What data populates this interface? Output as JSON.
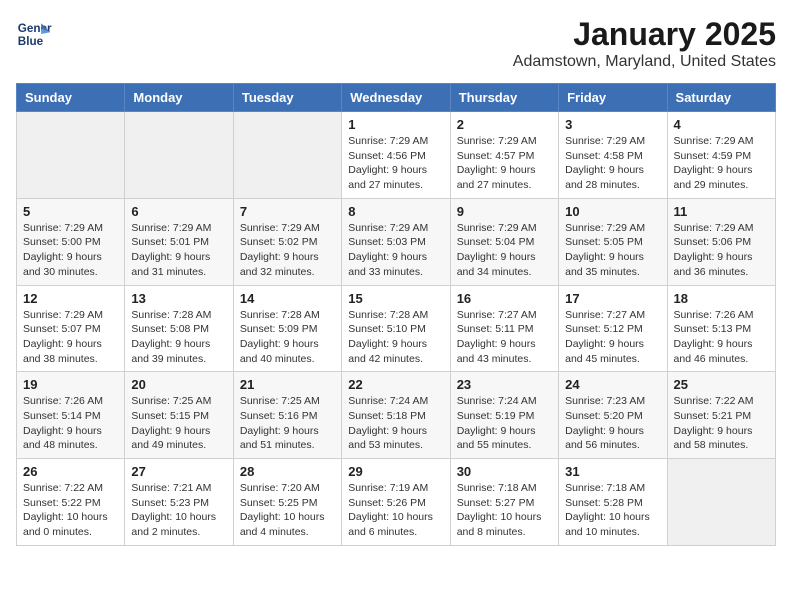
{
  "logo": {
    "line1": "General",
    "line2": "Blue"
  },
  "header": {
    "month": "January 2025",
    "location": "Adamstown, Maryland, United States"
  },
  "weekdays": [
    "Sunday",
    "Monday",
    "Tuesday",
    "Wednesday",
    "Thursday",
    "Friday",
    "Saturday"
  ],
  "weeks": [
    [
      {
        "day": "",
        "info": ""
      },
      {
        "day": "",
        "info": ""
      },
      {
        "day": "",
        "info": ""
      },
      {
        "day": "1",
        "info": "Sunrise: 7:29 AM\nSunset: 4:56 PM\nDaylight: 9 hours\nand 27 minutes."
      },
      {
        "day": "2",
        "info": "Sunrise: 7:29 AM\nSunset: 4:57 PM\nDaylight: 9 hours\nand 27 minutes."
      },
      {
        "day": "3",
        "info": "Sunrise: 7:29 AM\nSunset: 4:58 PM\nDaylight: 9 hours\nand 28 minutes."
      },
      {
        "day": "4",
        "info": "Sunrise: 7:29 AM\nSunset: 4:59 PM\nDaylight: 9 hours\nand 29 minutes."
      }
    ],
    [
      {
        "day": "5",
        "info": "Sunrise: 7:29 AM\nSunset: 5:00 PM\nDaylight: 9 hours\nand 30 minutes."
      },
      {
        "day": "6",
        "info": "Sunrise: 7:29 AM\nSunset: 5:01 PM\nDaylight: 9 hours\nand 31 minutes."
      },
      {
        "day": "7",
        "info": "Sunrise: 7:29 AM\nSunset: 5:02 PM\nDaylight: 9 hours\nand 32 minutes."
      },
      {
        "day": "8",
        "info": "Sunrise: 7:29 AM\nSunset: 5:03 PM\nDaylight: 9 hours\nand 33 minutes."
      },
      {
        "day": "9",
        "info": "Sunrise: 7:29 AM\nSunset: 5:04 PM\nDaylight: 9 hours\nand 34 minutes."
      },
      {
        "day": "10",
        "info": "Sunrise: 7:29 AM\nSunset: 5:05 PM\nDaylight: 9 hours\nand 35 minutes."
      },
      {
        "day": "11",
        "info": "Sunrise: 7:29 AM\nSunset: 5:06 PM\nDaylight: 9 hours\nand 36 minutes."
      }
    ],
    [
      {
        "day": "12",
        "info": "Sunrise: 7:29 AM\nSunset: 5:07 PM\nDaylight: 9 hours\nand 38 minutes."
      },
      {
        "day": "13",
        "info": "Sunrise: 7:28 AM\nSunset: 5:08 PM\nDaylight: 9 hours\nand 39 minutes."
      },
      {
        "day": "14",
        "info": "Sunrise: 7:28 AM\nSunset: 5:09 PM\nDaylight: 9 hours\nand 40 minutes."
      },
      {
        "day": "15",
        "info": "Sunrise: 7:28 AM\nSunset: 5:10 PM\nDaylight: 9 hours\nand 42 minutes."
      },
      {
        "day": "16",
        "info": "Sunrise: 7:27 AM\nSunset: 5:11 PM\nDaylight: 9 hours\nand 43 minutes."
      },
      {
        "day": "17",
        "info": "Sunrise: 7:27 AM\nSunset: 5:12 PM\nDaylight: 9 hours\nand 45 minutes."
      },
      {
        "day": "18",
        "info": "Sunrise: 7:26 AM\nSunset: 5:13 PM\nDaylight: 9 hours\nand 46 minutes."
      }
    ],
    [
      {
        "day": "19",
        "info": "Sunrise: 7:26 AM\nSunset: 5:14 PM\nDaylight: 9 hours\nand 48 minutes."
      },
      {
        "day": "20",
        "info": "Sunrise: 7:25 AM\nSunset: 5:15 PM\nDaylight: 9 hours\nand 49 minutes."
      },
      {
        "day": "21",
        "info": "Sunrise: 7:25 AM\nSunset: 5:16 PM\nDaylight: 9 hours\nand 51 minutes."
      },
      {
        "day": "22",
        "info": "Sunrise: 7:24 AM\nSunset: 5:18 PM\nDaylight: 9 hours\nand 53 minutes."
      },
      {
        "day": "23",
        "info": "Sunrise: 7:24 AM\nSunset: 5:19 PM\nDaylight: 9 hours\nand 55 minutes."
      },
      {
        "day": "24",
        "info": "Sunrise: 7:23 AM\nSunset: 5:20 PM\nDaylight: 9 hours\nand 56 minutes."
      },
      {
        "day": "25",
        "info": "Sunrise: 7:22 AM\nSunset: 5:21 PM\nDaylight: 9 hours\nand 58 minutes."
      }
    ],
    [
      {
        "day": "26",
        "info": "Sunrise: 7:22 AM\nSunset: 5:22 PM\nDaylight: 10 hours\nand 0 minutes."
      },
      {
        "day": "27",
        "info": "Sunrise: 7:21 AM\nSunset: 5:23 PM\nDaylight: 10 hours\nand 2 minutes."
      },
      {
        "day": "28",
        "info": "Sunrise: 7:20 AM\nSunset: 5:25 PM\nDaylight: 10 hours\nand 4 minutes."
      },
      {
        "day": "29",
        "info": "Sunrise: 7:19 AM\nSunset: 5:26 PM\nDaylight: 10 hours\nand 6 minutes."
      },
      {
        "day": "30",
        "info": "Sunrise: 7:18 AM\nSunset: 5:27 PM\nDaylight: 10 hours\nand 8 minutes."
      },
      {
        "day": "31",
        "info": "Sunrise: 7:18 AM\nSunset: 5:28 PM\nDaylight: 10 hours\nand 10 minutes."
      },
      {
        "day": "",
        "info": ""
      }
    ]
  ]
}
